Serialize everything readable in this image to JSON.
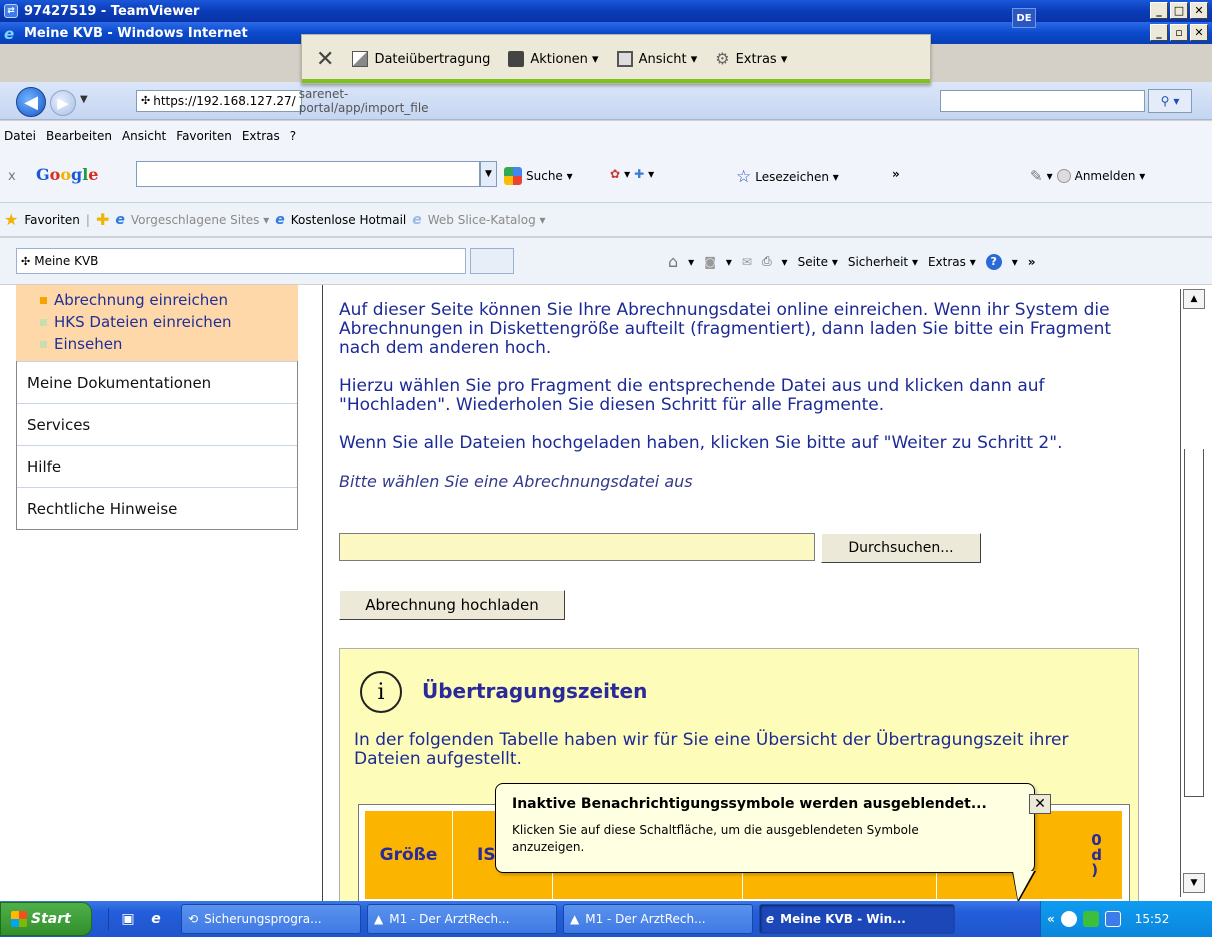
{
  "teamviewer": {
    "title": "97427519 - TeamViewer",
    "toolbar": {
      "close_label": "✕",
      "file_transfer": "Dateiübertragung",
      "actions": "Aktionen ▾",
      "view": "Ansicht ▾",
      "extras": "Extras ▾"
    }
  },
  "browser": {
    "window_title": "Meine KVB - Windows Internet",
    "url_scheme": "https://192.168.127.27/",
    "url_rest": "sarenet-portal/app/import_file",
    "menu": [
      "Datei",
      "Bearbeiten",
      "Ansicht",
      "Favoriten",
      "Extras",
      "?"
    ],
    "google_toolbar": {
      "close": "x",
      "logo": "Google",
      "search_label": "Suche ▾",
      "bookmarks_label": "Lesezeichen ▾",
      "more": "»",
      "signin_label": "Anmelden ▾"
    },
    "favorites": {
      "favorites_label": "Favoriten",
      "suggested_sites": "Vorgeschlagene Sites ▾",
      "hotmail": "Kostenlose Hotmail",
      "web_slice": "Web Slice-Katalog ▾"
    },
    "tab_title": "Meine KVB",
    "commands": {
      "page": "Seite ▾",
      "security": "Sicherheit ▾",
      "extras": "Extras ▾",
      "help": "?",
      "more": "»"
    }
  },
  "sidebar": {
    "submenu": [
      "Abrechnung einreichen",
      "HKS Dateien einreichen",
      "Einsehen"
    ],
    "items": [
      "Meine Dokumentationen",
      "Services",
      "Hilfe",
      "Rechtliche Hinweise"
    ]
  },
  "content": {
    "para1": "Auf dieser Seite können Sie Ihre Abrechnungsdatei online einreichen. Wenn ihr System die Abrechnungen in Diskettengröße aufteilt (fragmentiert), dann laden Sie bitte ein Fragment nach dem anderen hoch.",
    "para2": "Hierzu wählen Sie pro Fragment die entsprechende Datei aus und klicken dann auf \"Hochladen\". Wiederholen Sie diesen Schritt für alle Fragmente.",
    "para3": "Wenn Sie alle Dateien hochgeladen haben, klicken Sie bitte auf \"Weiter zu Schritt 2\".",
    "file_hint": "Bitte wählen Sie eine Abrechnungsdatei aus",
    "file_value": "",
    "browse_label": "Durchsuchen...",
    "upload_label": "Abrechnung hochladen",
    "info": {
      "icon": "i",
      "title": "Übertragungszeiten",
      "text": "In der folgenden Tabelle haben wir für Sie eine Übersicht der Übertragungszeit ihrer Dateien aufgestellt.",
      "col1": "Größe",
      "col2": "IS",
      "col_last": "0\nd\n)"
    }
  },
  "balloon": {
    "title": "Inaktive Benachrichtigungssymbole werden ausgeblendet...",
    "text": "Klicken Sie auf diese Schaltfläche, um die ausgeblendeten Symbole anzuzeigen.",
    "close": "✕"
  },
  "taskbar": {
    "start": "Start",
    "items": [
      "Sicherungsprogra...",
      "M1 - Der ArztRech...",
      "M1 - Der ArztRech...",
      "Meine KVB - Win..."
    ],
    "lang": "DE",
    "tray_expand": "«",
    "time": "15:52"
  },
  "colors": {
    "accent_orange": "#fbb500",
    "submenu_bg": "#fed8a8",
    "info_bg": "#fdfcb8",
    "link_blue": "#1c2a96"
  }
}
